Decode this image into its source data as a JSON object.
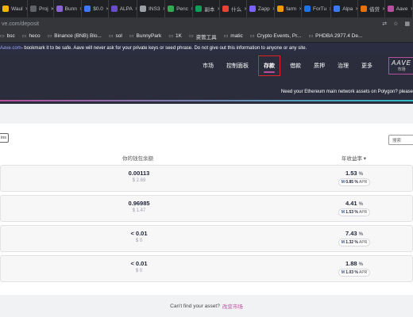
{
  "browser": {
    "tabs": [
      {
        "label": "Waul",
        "color": "#f4b400"
      },
      {
        "label": "Proj",
        "color": "#5f6368"
      },
      {
        "label": "Bunn",
        "color": "#8a63d2"
      },
      {
        "label": "$0.0",
        "color": "#3c79f5"
      },
      {
        "label": "ALPA",
        "color": "#6a4cc9"
      },
      {
        "label": "INS3",
        "color": "#9aa0a6"
      },
      {
        "label": "Penc",
        "color": "#34a853"
      },
      {
        "label": "副本",
        "color": "#0f9d58"
      },
      {
        "label": "什么",
        "color": "#ea4335"
      },
      {
        "label": "Zapp",
        "color": "#7b61ff"
      },
      {
        "label": "farm",
        "color": "#f29900"
      },
      {
        "label": "ForTu",
        "color": "#1a73e8"
      },
      {
        "label": "Alpa",
        "color": "#3c79f5"
      },
      {
        "label": "借贷",
        "color": "#e8710a"
      },
      {
        "label": "Aave",
        "color": "#b6509e"
      }
    ],
    "url_host": "ve.com",
    "url_path": "/deposit",
    "bookmarks": [
      "bsc",
      "heco",
      "Binance (BNB) Blo...",
      "sol",
      "BunnyPark",
      "1K",
      "资管工具",
      "matic",
      "Crypto Events, Pr...",
      "PHDBA 2977.4 De..."
    ]
  },
  "warning": {
    "link": "Aave.com",
    "text": " - bookmark it to be safe. Aave will never ask for your private keys or seed phrase. Do not give out this information to anyone or any site."
  },
  "nav": {
    "items": [
      "市场",
      "控制面板",
      "存款",
      "借款",
      "质押",
      "治理",
      "更多"
    ],
    "active_index": 2,
    "logo": "AAVE",
    "logo_sub": "市场"
  },
  "banner": "Need your Ethereum main network assets on Polygon? please",
  "toolbar": {
    "chip": "ins",
    "search_placeholder": "搜索"
  },
  "table": {
    "col_balance": "你的钱包余额",
    "col_apy": "年收益率 ▾",
    "rows": [
      {
        "balance": "0.00113",
        "usd": "$ 2.69",
        "apy": "1.53",
        "incentive": "0.85 %",
        "inc_label": "APR"
      },
      {
        "balance": "0.96985",
        "usd": "$ 1.47",
        "apy": "4.41",
        "incentive": "1.53 %",
        "inc_label": "APR"
      },
      {
        "balance": "< 0.01",
        "usd": "$ 0",
        "apy": "7.43",
        "incentive": "1.32 %",
        "inc_label": "APR"
      },
      {
        "balance": "< 0.01",
        "usd": "$ 0",
        "apy": "1.88",
        "incentive": "1.03 %",
        "inc_label": "APR"
      }
    ]
  },
  "footer": {
    "text": "Can't find your asset?",
    "link": "改变市场"
  }
}
